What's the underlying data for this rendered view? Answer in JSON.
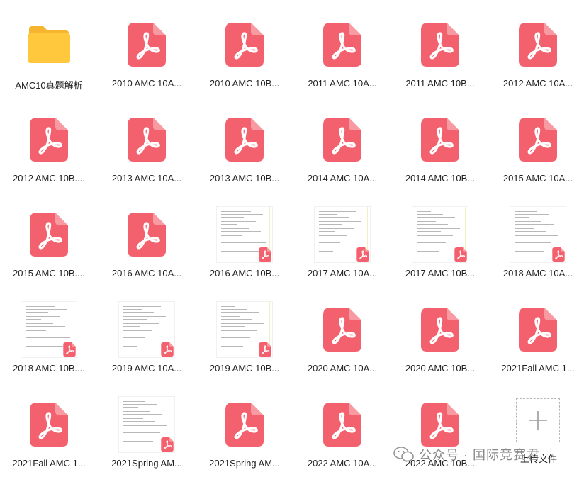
{
  "files": [
    {
      "label": "AMC10真题解析",
      "type": "folder"
    },
    {
      "label": "2010 AMC 10A...",
      "type": "pdf"
    },
    {
      "label": "2010 AMC 10B...",
      "type": "pdf"
    },
    {
      "label": "2011 AMC 10A...",
      "type": "pdf"
    },
    {
      "label": "2011 AMC 10B...",
      "type": "pdf"
    },
    {
      "label": "2012 AMC 10A...",
      "type": "pdf"
    },
    {
      "label": "2012 AMC 10B....",
      "type": "pdf"
    },
    {
      "label": "2013 AMC 10A...",
      "type": "pdf"
    },
    {
      "label": "2013 AMC 10B...",
      "type": "pdf"
    },
    {
      "label": "2014 AMC 10A...",
      "type": "pdf"
    },
    {
      "label": "2014 AMC 10B...",
      "type": "pdf"
    },
    {
      "label": "2015 AMC 10A...",
      "type": "pdf"
    },
    {
      "label": "2015 AMC 10B....",
      "type": "pdf"
    },
    {
      "label": "2016 AMC 10A...",
      "type": "pdf"
    },
    {
      "label": "2016 AMC 10B...",
      "type": "thumb"
    },
    {
      "label": "2017 AMC 10A...",
      "type": "thumb"
    },
    {
      "label": "2017 AMC 10B...",
      "type": "thumb"
    },
    {
      "label": "2018 AMC 10A...",
      "type": "thumb"
    },
    {
      "label": "2018 AMC 10B....",
      "type": "thumb"
    },
    {
      "label": "2019 AMC 10A...",
      "type": "thumb"
    },
    {
      "label": "2019 AMC 10B...",
      "type": "thumb"
    },
    {
      "label": "2020 AMC 10A...",
      "type": "pdf"
    },
    {
      "label": "2020 AMC 10B...",
      "type": "pdf"
    },
    {
      "label": "2021Fall AMC 1...",
      "type": "pdf"
    },
    {
      "label": "2021Fall AMC 1...",
      "type": "pdf"
    },
    {
      "label": "2021Spring AM...",
      "type": "thumb"
    },
    {
      "label": "2021Spring AM...",
      "type": "pdf"
    },
    {
      "label": "2022 AMC 10A...",
      "type": "pdf"
    },
    {
      "label": "2022 AMC 10B...",
      "type": "pdf"
    }
  ],
  "upload": {
    "label": "上传文件"
  },
  "watermark": {
    "text": "公众号 · 国际竞赛君"
  },
  "colors": {
    "pdf": "#f4616e",
    "folder": "#ffc83d",
    "text": "#222222"
  }
}
